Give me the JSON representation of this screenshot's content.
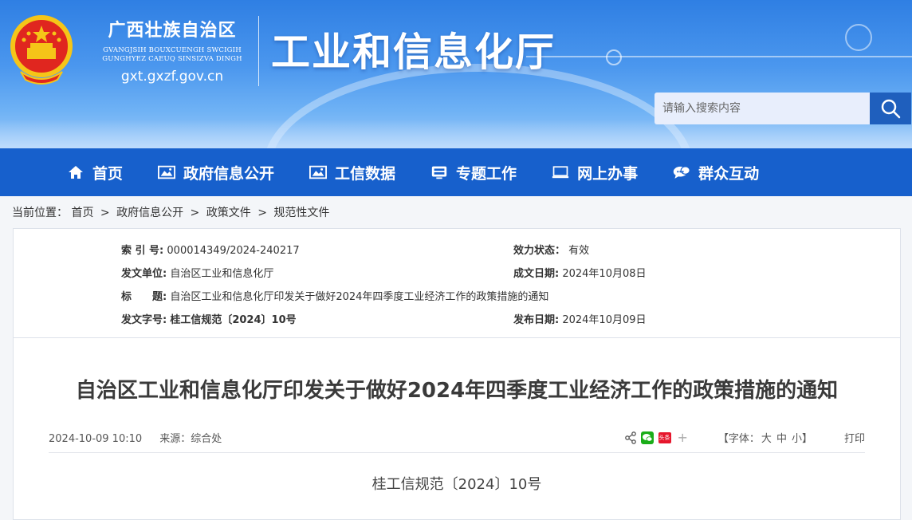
{
  "header": {
    "region_name": "广西壮族自治区",
    "region_zhuang_line1": "GVANGJSIH BOUXCUENGH SWCIGIH",
    "region_zhuang_line2": "GUNGHYEZ CAEUQ SINSIZVA DINGH",
    "region_url": "gxt.gxzf.gov.cn",
    "department": "工业和信息化厅",
    "search_placeholder": "请输入搜索内容"
  },
  "nav": {
    "items": [
      {
        "label": "首页",
        "icon": "home-icon"
      },
      {
        "label": "政府信息公开",
        "icon": "image-icon"
      },
      {
        "label": "工信数据",
        "icon": "image-icon"
      },
      {
        "label": "专题工作",
        "icon": "monitor-icon"
      },
      {
        "label": "网上办事",
        "icon": "laptop-icon"
      },
      {
        "label": "群众互动",
        "icon": "chat-icon"
      }
    ]
  },
  "breadcrumb": {
    "prefix": "当前位置：",
    "items": [
      "首页",
      "政府信息公开",
      "政策文件",
      "规范性文件"
    ],
    "sep": ">"
  },
  "meta": {
    "index_key": "索 引 号:",
    "index_val": "000014349/2024-240217",
    "status_key": "效力状态：",
    "status_val": "有效",
    "issuer_key": "发文单位:",
    "issuer_val": "自治区工业和信息化厅",
    "created_key": "成文日期:",
    "created_val": "2024年10月08日",
    "title_key": "标　　题:",
    "title_val": "自治区工业和信息化厅印发关于做好2024年四季度工业经济工作的政策措施的通知",
    "docno_key": "发文字号:",
    "docno_val": "桂工信规范〔2024〕10号",
    "published_key": "发布日期:",
    "published_val": "2024年10月09日"
  },
  "article": {
    "title": "自治区工业和信息化厅印发关于做好2024年四季度工业经济工作的政策措施的通知",
    "datetime": "2024-10-09 10:10",
    "source": "来源：综合处",
    "font_label": "【字体：",
    "font_large": "大",
    "font_medium": "中",
    "font_small": "小",
    "font_close": "】",
    "print_label": "打印",
    "doc_number": "桂工信规范〔2024〕10号",
    "plus": "+",
    "weibo_badge": "头条"
  },
  "colors": {
    "nav_bg": "#1760cc",
    "banner_top": "#2f7fe3",
    "search_btn": "#1f5fbd",
    "wechat_green": "#1aad19",
    "weibo_red": "#e6162d"
  }
}
